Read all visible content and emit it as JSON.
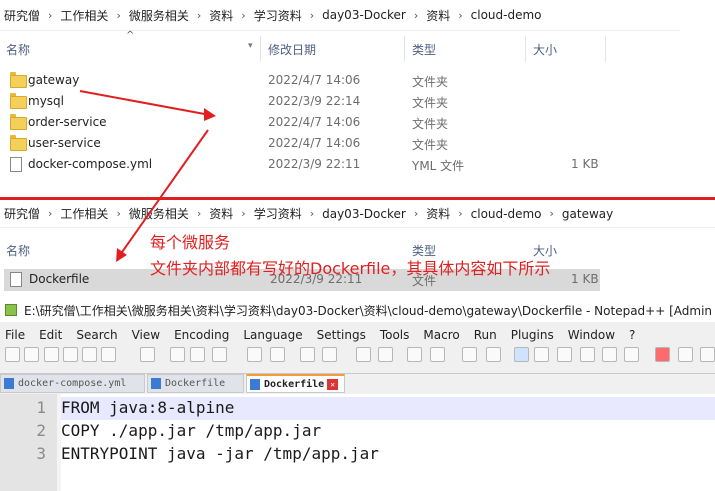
{
  "explorer_top": {
    "breadcrumb": [
      "研究僧",
      "工作相关",
      "微服务相关",
      "资料",
      "学习资料",
      "day03-Docker",
      "资料",
      "cloud-demo"
    ],
    "columns": {
      "name": "名称",
      "modified": "修改日期",
      "type": "类型",
      "size": "大小"
    },
    "rows": [
      {
        "name": "gateway",
        "modified": "2022/4/7 14:06",
        "type": "文件夹",
        "size": "",
        "icon": "folder-icon"
      },
      {
        "name": "mysql",
        "modified": "2022/3/9 22:14",
        "type": "文件夹",
        "size": "",
        "icon": "folder-icon"
      },
      {
        "name": "order-service",
        "modified": "2022/4/7 14:06",
        "type": "文件夹",
        "size": "",
        "icon": "folder-icon"
      },
      {
        "name": "user-service",
        "modified": "2022/4/7 14:06",
        "type": "文件夹",
        "size": "",
        "icon": "folder-icon"
      },
      {
        "name": "docker-compose.yml",
        "modified": "2022/3/9 22:11",
        "type": "YML 文件",
        "size": "1 KB",
        "icon": "file-icon"
      }
    ]
  },
  "explorer_bottom": {
    "breadcrumb": [
      "研究僧",
      "工作相关",
      "微服务相关",
      "资料",
      "学习资料",
      "day03-Docker",
      "资料",
      "cloud-demo",
      "gateway"
    ],
    "columns": {
      "name": "名称",
      "type": "类型",
      "size": "大小"
    },
    "row": {
      "name": "Dockerfile",
      "modified": "2022/3/9 22:11",
      "type": "文件",
      "size": "1 KB"
    }
  },
  "annotation": {
    "line1": "每个微服务",
    "line2": "文件夹内部都有写好的Dockerfile，其具体内容如下所示",
    "color": "#e02020"
  },
  "notepad": {
    "title": "E:\\研究僧\\工作相关\\微服务相关\\资料\\学习资料\\day03-Docker\\资料\\cloud-demo\\gateway\\Dockerfile - Notepad++ [Admin",
    "menu": [
      "File",
      "Edit",
      "Search",
      "View",
      "Encoding",
      "Language",
      "Settings",
      "Tools",
      "Macro",
      "Run",
      "Plugins",
      "Window",
      "?"
    ],
    "tabs": [
      {
        "label": "docker-compose.yml"
      },
      {
        "label": "Dockerfile"
      },
      {
        "label": "Dockerfile"
      }
    ],
    "active_tab": 2,
    "lines": [
      {
        "num": "1",
        "text": "FROM java:8-alpine"
      },
      {
        "num": "2",
        "text": "COPY ./app.jar /tmp/app.jar"
      },
      {
        "num": "3",
        "text": "ENTRYPOINT java -jar /tmp/app.jar"
      }
    ]
  }
}
